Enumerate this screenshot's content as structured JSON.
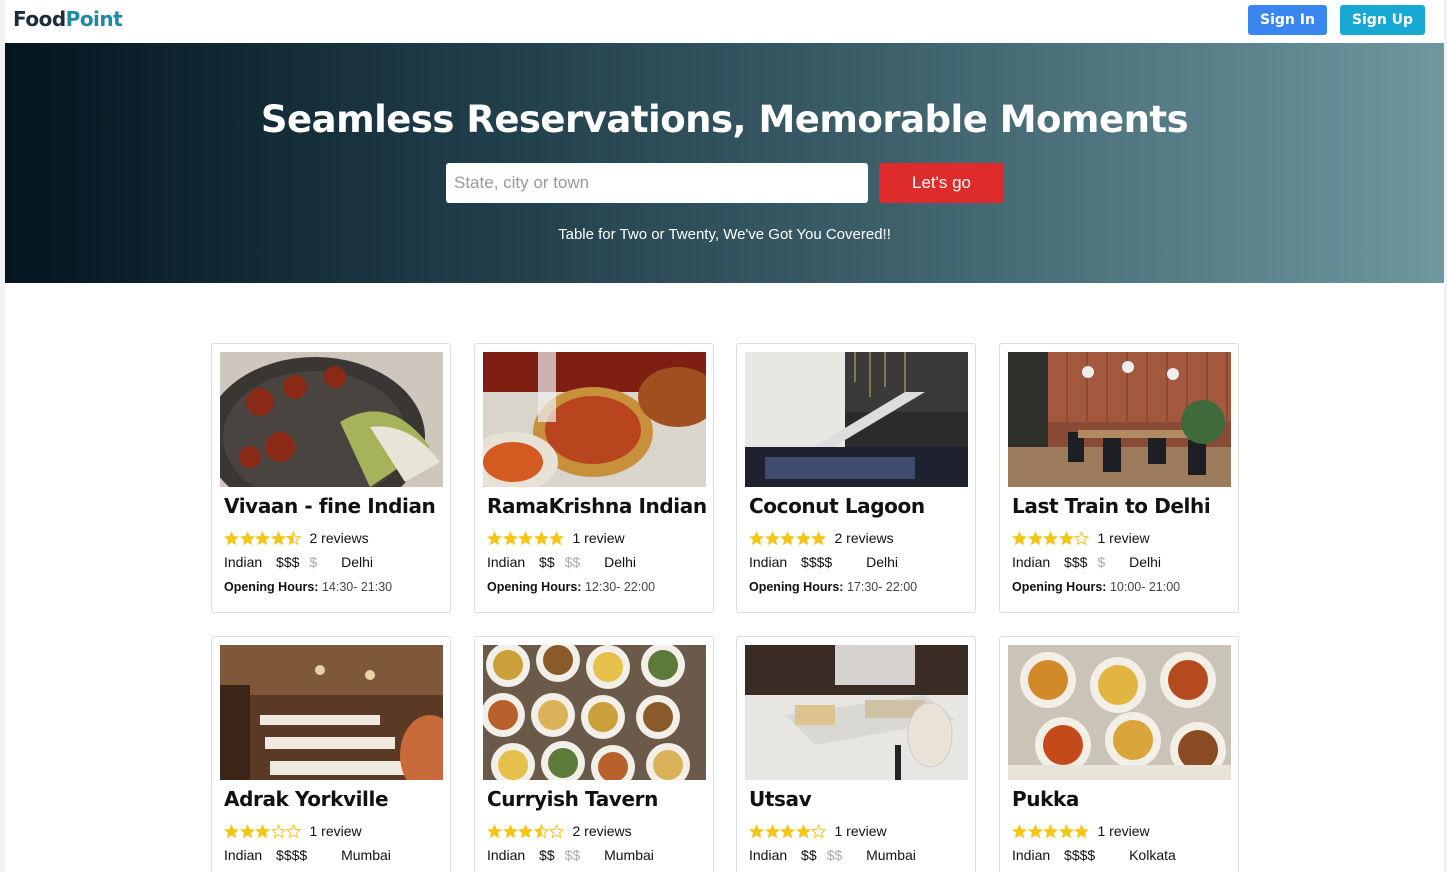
{
  "brand": {
    "part1": "Food",
    "part2": "Point"
  },
  "nav": {
    "signin_label": "Sign In",
    "signup_label": "Sign Up"
  },
  "hero": {
    "title": "Seamless Reservations, Memorable Moments",
    "search_placeholder": "State, city or town",
    "search_value": "",
    "go_label": "Let's go",
    "subtitle": "Table for Two or Twenty, We've Got You Covered!!"
  },
  "colors": {
    "signin_bg": "#3a86f0",
    "signup_bg": "#17a9d3",
    "go_bg": "#de2b2b",
    "star": "#f5c518",
    "brand_dark": "#1f2d3a",
    "brand_accent": "#1f8aa6"
  },
  "hours_label": "Opening Hours:",
  "restaurants": [
    {
      "name": "Vivaan - fine Indian",
      "rating": 4.5,
      "reviews": "2 reviews",
      "cuisine": "Indian",
      "price_on": "$$$",
      "price_off": "$",
      "city": "Delhi",
      "hours": "14:30- 21:30",
      "image": "plated-food-photo"
    },
    {
      "name": "RamaKrishna Indian",
      "rating": 5,
      "reviews": "1 review",
      "cuisine": "Indian",
      "price_on": "$$",
      "price_off": "$$",
      "city": "Delhi",
      "hours": "12:30- 22:00",
      "image": "curry-dishes-photo"
    },
    {
      "name": "Coconut Lagoon",
      "rating": 5,
      "reviews": "2 reviews",
      "cuisine": "Indian",
      "price_on": "$$$$",
      "price_off": "",
      "city": "Delhi",
      "hours": "17:30- 22:00",
      "image": "interior-photo"
    },
    {
      "name": "Last Train to Delhi",
      "rating": 4,
      "reviews": "1 review",
      "cuisine": "Indian",
      "price_on": "$$$",
      "price_off": "$",
      "city": "Delhi",
      "hours": "10:00- 21:00",
      "image": "dining-room-photo"
    },
    {
      "name": "Adrak Yorkville",
      "rating": 3,
      "reviews": "1 review",
      "cuisine": "Indian",
      "price_on": "$$$$",
      "price_off": "",
      "city": "Mumbai",
      "hours": "",
      "image": "lounge-photo"
    },
    {
      "name": "Curryish Tavern",
      "rating": 3.5,
      "reviews": "2 reviews",
      "cuisine": "Indian",
      "price_on": "$$",
      "price_off": "$$",
      "city": "Mumbai",
      "hours": "",
      "image": "many-plates-photo"
    },
    {
      "name": "Utsav",
      "rating": 4,
      "reviews": "1 review",
      "cuisine": "Indian",
      "price_on": "$$",
      "price_off": "$$",
      "city": "Mumbai",
      "hours": "",
      "image": "table-setting-photo"
    },
    {
      "name": "Pukka",
      "rating": 5,
      "reviews": "1 review",
      "cuisine": "Indian",
      "price_on": "$$$$",
      "price_off": "",
      "city": "Kolkata",
      "hours": "",
      "image": "curry-spread-photo"
    }
  ]
}
